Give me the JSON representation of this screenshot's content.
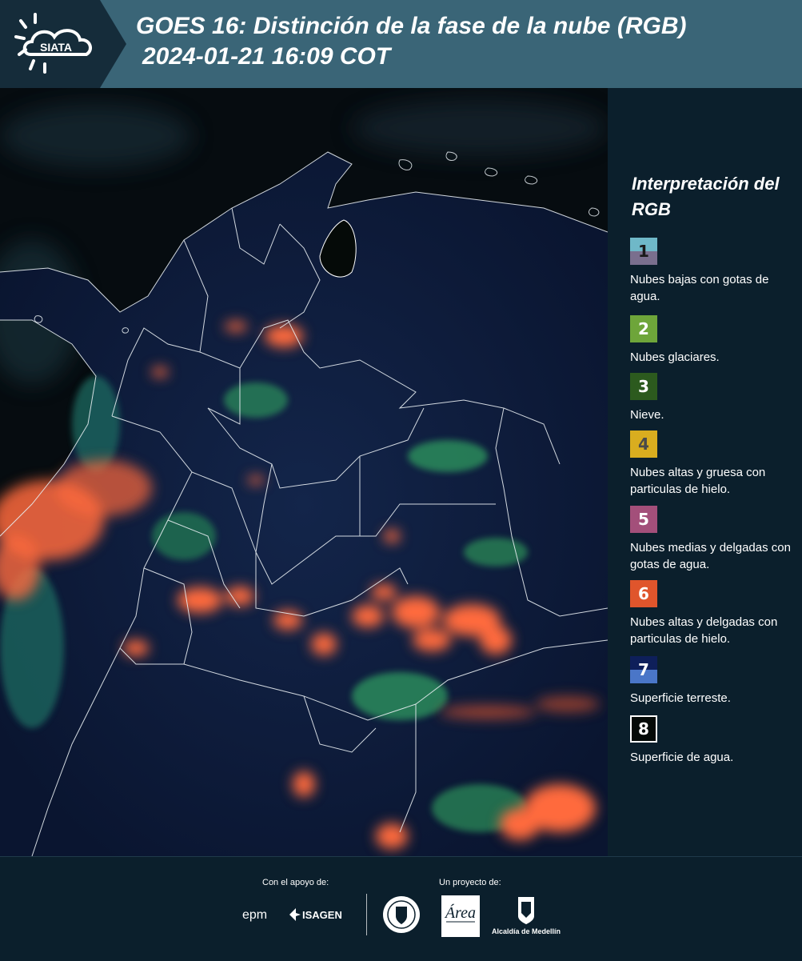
{
  "header": {
    "logo_text": "SIATA",
    "title_line1": "GOES 16: Distinción de la fase de la nube (RGB)",
    "title_line2": "2024-01-21 16:09 COT"
  },
  "legend": {
    "title": "Interpretación del RGB",
    "items": [
      {
        "number": "1",
        "label": "Nubes bajas con gotas de agua.",
        "colors": [
          "#6fb8c8",
          "#7a6f8e"
        ]
      },
      {
        "number": "2",
        "label": "Nubes glaciares.",
        "colors": [
          "#6ea53a"
        ]
      },
      {
        "number": "3",
        "label": "Nieve.",
        "colors": [
          "#2c5a1e"
        ]
      },
      {
        "number": "4",
        "label": "Nubes altas y gruesa con particulas de hielo.",
        "colors": [
          "#d9ad1f"
        ]
      },
      {
        "number": "5",
        "label": "Nubes medias y delgadas con gotas de agua.",
        "colors": [
          "#a34f7a"
        ]
      },
      {
        "number": "6",
        "label": "Nubes altas y delgadas con particulas de hielo.",
        "colors": [
          "#e0552c"
        ]
      },
      {
        "number": "7",
        "label": "Superficie terreste.",
        "colors": [
          "#0e1f5a",
          "#4a76c8"
        ]
      },
      {
        "number": "8",
        "label": "Superficie de agua.",
        "colors": [
          "#050a08"
        ]
      }
    ]
  },
  "footer": {
    "support_label": "Con el apoyo de:",
    "project_label": "Un proyecto de:",
    "sponsors": [
      "epm",
      "ISAGEN"
    ],
    "partners": [
      "Área Metropolitana Valle de Aburrá",
      "Alcaldía de Medellín"
    ]
  },
  "colors": {
    "header_bg": "#3a6577",
    "page_bg": "#0b1f2c",
    "cloud_ice_thin": "#ff6a3d",
    "glaciated": "#35c27a",
    "land": "#0d1a3a"
  }
}
